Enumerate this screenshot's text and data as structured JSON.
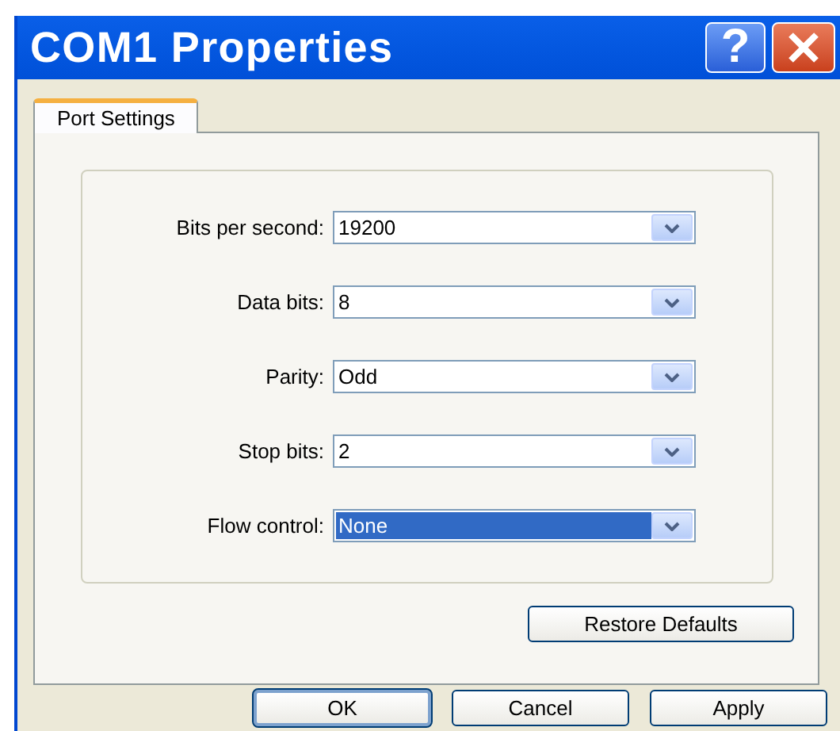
{
  "window": {
    "title": "COM1 Properties",
    "title_buttons": [
      {
        "kind": "help",
        "label": "?"
      },
      {
        "kind": "close"
      }
    ]
  },
  "tabs": [
    {
      "label": "Port Settings",
      "selected": true
    }
  ],
  "fields": [
    {
      "label": "Bits per second:",
      "value": "19200",
      "highlighted": false
    },
    {
      "label": "Data bits:",
      "value": "8",
      "highlighted": false
    },
    {
      "label": "Parity:",
      "value": "Odd",
      "highlighted": false
    },
    {
      "label": "Stop bits:",
      "value": "2",
      "highlighted": false
    },
    {
      "label": "Flow control:",
      "value": "None",
      "highlighted": true
    }
  ],
  "restore_button": "Restore Defaults",
  "buttons": [
    {
      "label": "OK",
      "default": true
    },
    {
      "label": "Cancel",
      "default": false
    },
    {
      "label": "Apply",
      "default": false
    }
  ]
}
